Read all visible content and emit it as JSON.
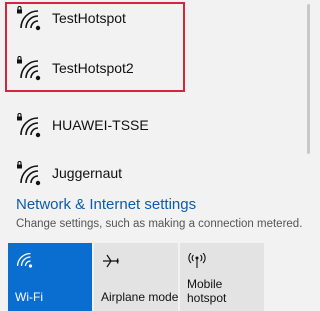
{
  "networks": [
    {
      "name": "TestHotspot",
      "icon": "wifi-secured-icon"
    },
    {
      "name": "TestHotspot2",
      "icon": "wifi-secured-icon"
    },
    {
      "name": "HUAWEI-TSSE",
      "icon": "wifi-secured-icon"
    },
    {
      "name": "Juggernaut",
      "icon": "wifi-secured-icon"
    }
  ],
  "settings": {
    "title": "Network & Internet settings",
    "subtitle": "Change settings, such as making a connection metered."
  },
  "quick_actions": [
    {
      "label": "Wi-Fi",
      "icon": "wifi-icon",
      "active": true
    },
    {
      "label": "Airplane mode",
      "icon": "airplane-icon",
      "active": false
    },
    {
      "label_line1": "Mobile",
      "label_line2": "hotspot",
      "icon": "hotspot-icon",
      "active": false
    }
  ],
  "colors": {
    "accent": "#0a6ed1",
    "link": "#0b5cad",
    "highlight_border": "#d0273c",
    "background": "#f2f2f2"
  }
}
